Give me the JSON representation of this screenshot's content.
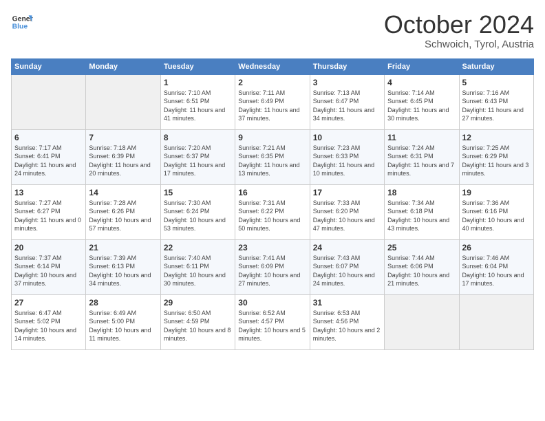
{
  "header": {
    "logo_line1": "General",
    "logo_line2": "Blue",
    "month": "October 2024",
    "location": "Schwoich, Tyrol, Austria"
  },
  "days_of_week": [
    "Sunday",
    "Monday",
    "Tuesday",
    "Wednesday",
    "Thursday",
    "Friday",
    "Saturday"
  ],
  "weeks": [
    [
      {
        "day": "",
        "empty": true
      },
      {
        "day": "",
        "empty": true
      },
      {
        "day": "1",
        "sunrise": "Sunrise: 7:10 AM",
        "sunset": "Sunset: 6:51 PM",
        "daylight": "Daylight: 11 hours and 41 minutes."
      },
      {
        "day": "2",
        "sunrise": "Sunrise: 7:11 AM",
        "sunset": "Sunset: 6:49 PM",
        "daylight": "Daylight: 11 hours and 37 minutes."
      },
      {
        "day": "3",
        "sunrise": "Sunrise: 7:13 AM",
        "sunset": "Sunset: 6:47 PM",
        "daylight": "Daylight: 11 hours and 34 minutes."
      },
      {
        "day": "4",
        "sunrise": "Sunrise: 7:14 AM",
        "sunset": "Sunset: 6:45 PM",
        "daylight": "Daylight: 11 hours and 30 minutes."
      },
      {
        "day": "5",
        "sunrise": "Sunrise: 7:16 AM",
        "sunset": "Sunset: 6:43 PM",
        "daylight": "Daylight: 11 hours and 27 minutes."
      }
    ],
    [
      {
        "day": "6",
        "sunrise": "Sunrise: 7:17 AM",
        "sunset": "Sunset: 6:41 PM",
        "daylight": "Daylight: 11 hours and 24 minutes."
      },
      {
        "day": "7",
        "sunrise": "Sunrise: 7:18 AM",
        "sunset": "Sunset: 6:39 PM",
        "daylight": "Daylight: 11 hours and 20 minutes."
      },
      {
        "day": "8",
        "sunrise": "Sunrise: 7:20 AM",
        "sunset": "Sunset: 6:37 PM",
        "daylight": "Daylight: 11 hours and 17 minutes."
      },
      {
        "day": "9",
        "sunrise": "Sunrise: 7:21 AM",
        "sunset": "Sunset: 6:35 PM",
        "daylight": "Daylight: 11 hours and 13 minutes."
      },
      {
        "day": "10",
        "sunrise": "Sunrise: 7:23 AM",
        "sunset": "Sunset: 6:33 PM",
        "daylight": "Daylight: 11 hours and 10 minutes."
      },
      {
        "day": "11",
        "sunrise": "Sunrise: 7:24 AM",
        "sunset": "Sunset: 6:31 PM",
        "daylight": "Daylight: 11 hours and 7 minutes."
      },
      {
        "day": "12",
        "sunrise": "Sunrise: 7:25 AM",
        "sunset": "Sunset: 6:29 PM",
        "daylight": "Daylight: 11 hours and 3 minutes."
      }
    ],
    [
      {
        "day": "13",
        "sunrise": "Sunrise: 7:27 AM",
        "sunset": "Sunset: 6:27 PM",
        "daylight": "Daylight: 11 hours and 0 minutes."
      },
      {
        "day": "14",
        "sunrise": "Sunrise: 7:28 AM",
        "sunset": "Sunset: 6:26 PM",
        "daylight": "Daylight: 10 hours and 57 minutes."
      },
      {
        "day": "15",
        "sunrise": "Sunrise: 7:30 AM",
        "sunset": "Sunset: 6:24 PM",
        "daylight": "Daylight: 10 hours and 53 minutes."
      },
      {
        "day": "16",
        "sunrise": "Sunrise: 7:31 AM",
        "sunset": "Sunset: 6:22 PM",
        "daylight": "Daylight: 10 hours and 50 minutes."
      },
      {
        "day": "17",
        "sunrise": "Sunrise: 7:33 AM",
        "sunset": "Sunset: 6:20 PM",
        "daylight": "Daylight: 10 hours and 47 minutes."
      },
      {
        "day": "18",
        "sunrise": "Sunrise: 7:34 AM",
        "sunset": "Sunset: 6:18 PM",
        "daylight": "Daylight: 10 hours and 43 minutes."
      },
      {
        "day": "19",
        "sunrise": "Sunrise: 7:36 AM",
        "sunset": "Sunset: 6:16 PM",
        "daylight": "Daylight: 10 hours and 40 minutes."
      }
    ],
    [
      {
        "day": "20",
        "sunrise": "Sunrise: 7:37 AM",
        "sunset": "Sunset: 6:14 PM",
        "daylight": "Daylight: 10 hours and 37 minutes."
      },
      {
        "day": "21",
        "sunrise": "Sunrise: 7:39 AM",
        "sunset": "Sunset: 6:13 PM",
        "daylight": "Daylight: 10 hours and 34 minutes."
      },
      {
        "day": "22",
        "sunrise": "Sunrise: 7:40 AM",
        "sunset": "Sunset: 6:11 PM",
        "daylight": "Daylight: 10 hours and 30 minutes."
      },
      {
        "day": "23",
        "sunrise": "Sunrise: 7:41 AM",
        "sunset": "Sunset: 6:09 PM",
        "daylight": "Daylight: 10 hours and 27 minutes."
      },
      {
        "day": "24",
        "sunrise": "Sunrise: 7:43 AM",
        "sunset": "Sunset: 6:07 PM",
        "daylight": "Daylight: 10 hours and 24 minutes."
      },
      {
        "day": "25",
        "sunrise": "Sunrise: 7:44 AM",
        "sunset": "Sunset: 6:06 PM",
        "daylight": "Daylight: 10 hours and 21 minutes."
      },
      {
        "day": "26",
        "sunrise": "Sunrise: 7:46 AM",
        "sunset": "Sunset: 6:04 PM",
        "daylight": "Daylight: 10 hours and 17 minutes."
      }
    ],
    [
      {
        "day": "27",
        "sunrise": "Sunrise: 6:47 AM",
        "sunset": "Sunset: 5:02 PM",
        "daylight": "Daylight: 10 hours and 14 minutes."
      },
      {
        "day": "28",
        "sunrise": "Sunrise: 6:49 AM",
        "sunset": "Sunset: 5:00 PM",
        "daylight": "Daylight: 10 hours and 11 minutes."
      },
      {
        "day": "29",
        "sunrise": "Sunrise: 6:50 AM",
        "sunset": "Sunset: 4:59 PM",
        "daylight": "Daylight: 10 hours and 8 minutes."
      },
      {
        "day": "30",
        "sunrise": "Sunrise: 6:52 AM",
        "sunset": "Sunset: 4:57 PM",
        "daylight": "Daylight: 10 hours and 5 minutes."
      },
      {
        "day": "31",
        "sunrise": "Sunrise: 6:53 AM",
        "sunset": "Sunset: 4:56 PM",
        "daylight": "Daylight: 10 hours and 2 minutes."
      },
      {
        "day": "",
        "empty": true
      },
      {
        "day": "",
        "empty": true
      }
    ]
  ]
}
